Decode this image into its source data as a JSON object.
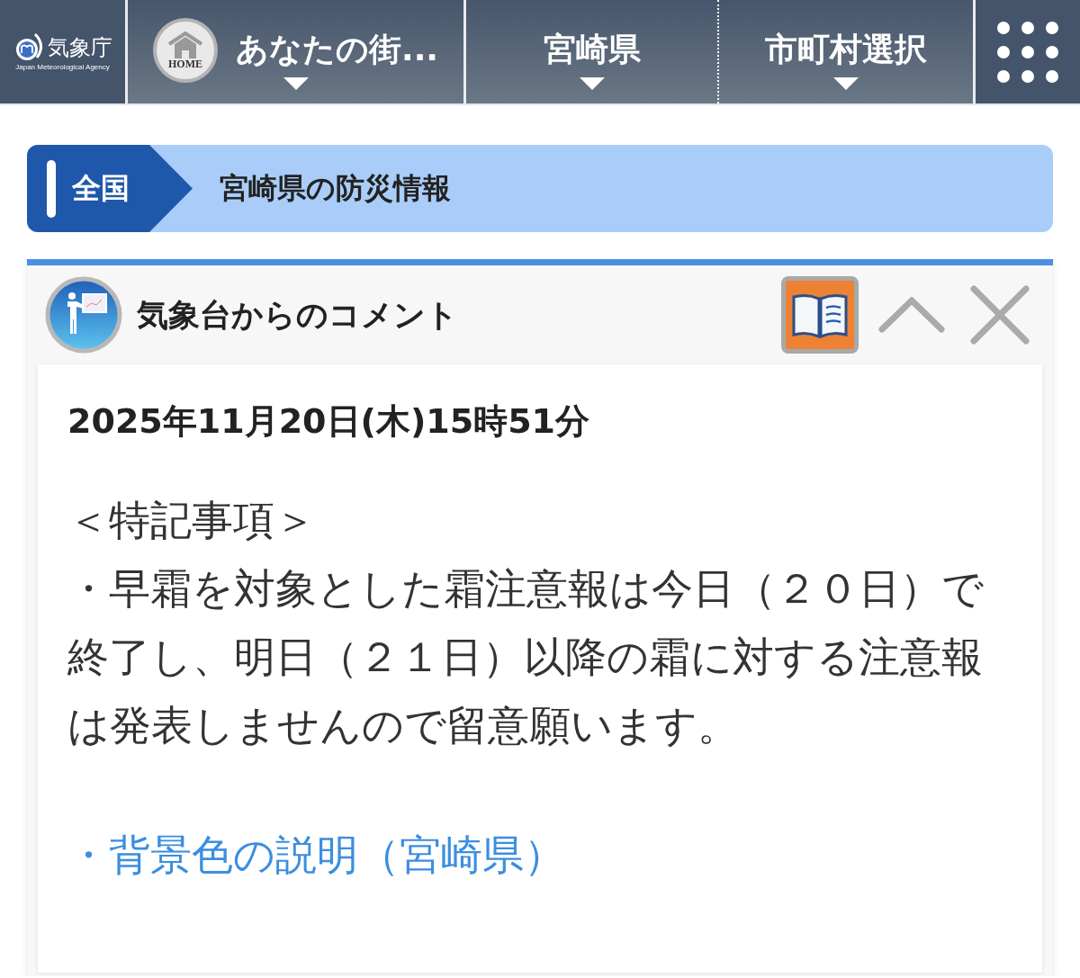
{
  "header": {
    "logo": {
      "name": "気象庁",
      "subtitle": "Japan Meteorological Agency"
    },
    "menus": [
      {
        "kind": "home",
        "icon_label": "HOME",
        "label": "あなたの街..."
      },
      {
        "kind": "plain",
        "label": "宮崎県"
      },
      {
        "kind": "plain",
        "label": "市町村選択"
      }
    ]
  },
  "breadcrumb": [
    {
      "label": "全国"
    },
    {
      "label": "宮崎県の防災情報"
    }
  ],
  "panel": {
    "title": "気象台からのコメント",
    "expanded": true,
    "date": "2025年11月20日(木)15時51分",
    "paragraphs": [
      "＜特記事項＞",
      "・早霜を対象とした霜注意報は今日（２０日）で終了し、明日（２１日）以降の霜に対する注意報は発表しませんので留意願います。"
    ],
    "links": [
      "・背景色の説明（宮崎県）"
    ]
  }
}
